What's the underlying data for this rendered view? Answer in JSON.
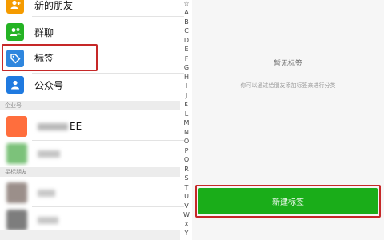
{
  "left": {
    "items": [
      {
        "label": "新的朋友",
        "icon": "new-friend-icon",
        "icon_color": "#f59b00"
      },
      {
        "label": "群聊",
        "icon": "group-icon",
        "icon_color": "#24b324"
      },
      {
        "label": "标签",
        "icon": "tag-icon",
        "icon_color": "#2e86de"
      },
      {
        "label": "公众号",
        "icon": "official-account-icon",
        "icon_color": "#1f7ae0"
      }
    ],
    "section_enterprise": "企业号",
    "enterprise_items": [
      {
        "label": "EE",
        "avatar_color": "#ff6e3d"
      },
      {
        "label": "",
        "avatar_color": "#7cc27a"
      }
    ],
    "section_starred": "星标朋友",
    "starred_items": [
      {
        "label": "",
        "avatar_color": "#9b8f8a"
      },
      {
        "label": "",
        "avatar_color": "#7d7d7d"
      }
    ]
  },
  "alphabet": {
    "star": "☆",
    "letters": [
      "A",
      "B",
      "C",
      "D",
      "E",
      "F",
      "G",
      "H",
      "I",
      "J",
      "K",
      "L",
      "M",
      "N",
      "O",
      "P",
      "Q",
      "R",
      "S",
      "T",
      "U",
      "V",
      "W",
      "X",
      "Y"
    ]
  },
  "right": {
    "empty_title": "暂无标签",
    "empty_desc": "你可以通过给朋友添加标签来进行分类",
    "button_label": "新建标签",
    "button_color": "#1aad19"
  },
  "highlight_color": "#c62828"
}
